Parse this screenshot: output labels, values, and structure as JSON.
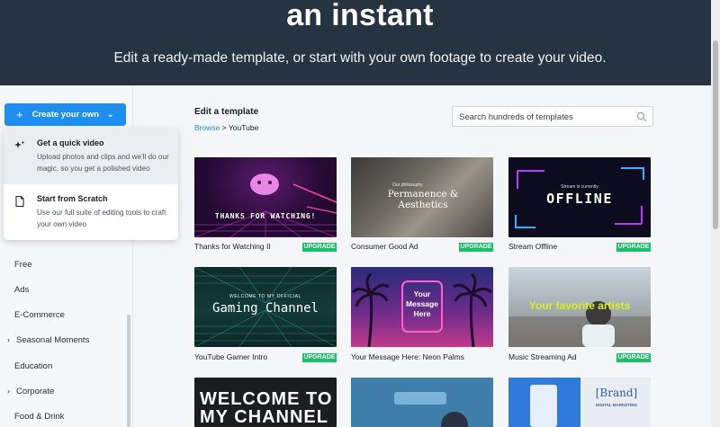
{
  "hero": {
    "title": "an instant",
    "subtitle": "Edit a ready-made template, or start with your own footage to create your video."
  },
  "create_button": {
    "label": "Create your own"
  },
  "dropdown": {
    "options": [
      {
        "title": "Get a quick video",
        "description": "Upload photos and clips and we'll do our magic, so you get a polished video",
        "icon": "sparkle-icon"
      },
      {
        "title": "Start from Scratch",
        "description": "Use our full suite of editing tools to craft your own video",
        "icon": "document-icon"
      }
    ]
  },
  "sidebar": {
    "items": [
      {
        "label": "Free",
        "expandable": false
      },
      {
        "label": "Ads",
        "expandable": false
      },
      {
        "label": "E-Commerce",
        "expandable": false
      },
      {
        "label": "Seasonal Moments",
        "expandable": true
      },
      {
        "label": "Education",
        "expandable": false
      },
      {
        "label": "Corporate",
        "expandable": true
      },
      {
        "label": "Food & Drink",
        "expandable": false
      }
    ]
  },
  "main": {
    "title": "Edit a template",
    "breadcrumb": {
      "link": "Browse",
      "separator": ">",
      "current": "YouTube"
    },
    "search": {
      "placeholder": "Search hundreds of templates",
      "value": ""
    }
  },
  "badge_label": "UPGRADE",
  "colors": {
    "accent": "#1f8ef1",
    "hero_bg": "#263340",
    "upgrade": "#1bbf6a"
  },
  "templates": [
    {
      "name": "Thanks for Watching II",
      "thumb_text": "THANKS FOR WATCHING!",
      "upgrade": true
    },
    {
      "name": "Consumer Good Ad",
      "thumb_kicker": "Our philosophy",
      "thumb_text": "Permanence & Aesthetics",
      "upgrade": true
    },
    {
      "name": "Stream Offline",
      "thumb_kicker": "Stream is currently",
      "thumb_text": "OFFLINE",
      "upgrade": true
    },
    {
      "name": "YouTube Gamer Intro",
      "thumb_kicker": "WELCOME TO MY OFFICIAL",
      "thumb_text": "Gaming Channel",
      "upgrade": true
    },
    {
      "name": "Your Message Here: Neon Palms",
      "thumb_text": "Your Message Here",
      "upgrade": false
    },
    {
      "name": "Music Streaming Ad",
      "thumb_text": "Your favorite artists",
      "upgrade": true
    },
    {
      "name": "",
      "thumb_text": "WELCOME TO MY CHANNEL",
      "upgrade": false
    },
    {
      "name": "",
      "thumb_text": "",
      "upgrade": false
    },
    {
      "name": "",
      "thumb_text": "[Brand]",
      "thumb_kicker": "DIGITAL MARKETING",
      "upgrade": false
    }
  ]
}
